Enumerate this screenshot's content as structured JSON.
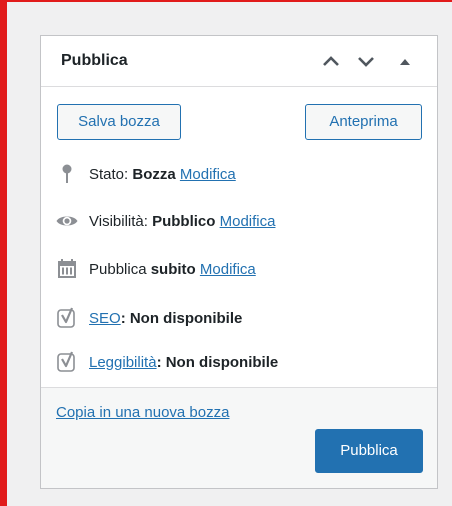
{
  "panel": {
    "title": "Pubblica",
    "icons": {
      "move_up": "chevron-up-icon",
      "move_down": "chevron-down-icon",
      "toggle": "triangle-up-icon"
    }
  },
  "actions": {
    "save_draft": "Salva bozza",
    "preview": "Anteprima"
  },
  "status": {
    "label": "Stato:",
    "value": "Bozza",
    "edit": "Modifica"
  },
  "visibility": {
    "label": "Visibilità:",
    "value": "Pubblico",
    "edit": "Modifica"
  },
  "publish_time": {
    "label": "Pubblica",
    "value": "subito",
    "edit": "Modifica"
  },
  "seo": {
    "link": "SEO",
    "suffix": ": Non disponibile"
  },
  "readability": {
    "link": "Leggibilità",
    "suffix": ": Non disponibile"
  },
  "footer": {
    "copy_link": "Copia in una nuova bozza",
    "publish_button": "Pubblica"
  },
  "colors": {
    "accent": "#2271b1",
    "frame_border": "#e11b1b",
    "panel_border": "#c3c4c7",
    "icon": "#8c8f94"
  }
}
